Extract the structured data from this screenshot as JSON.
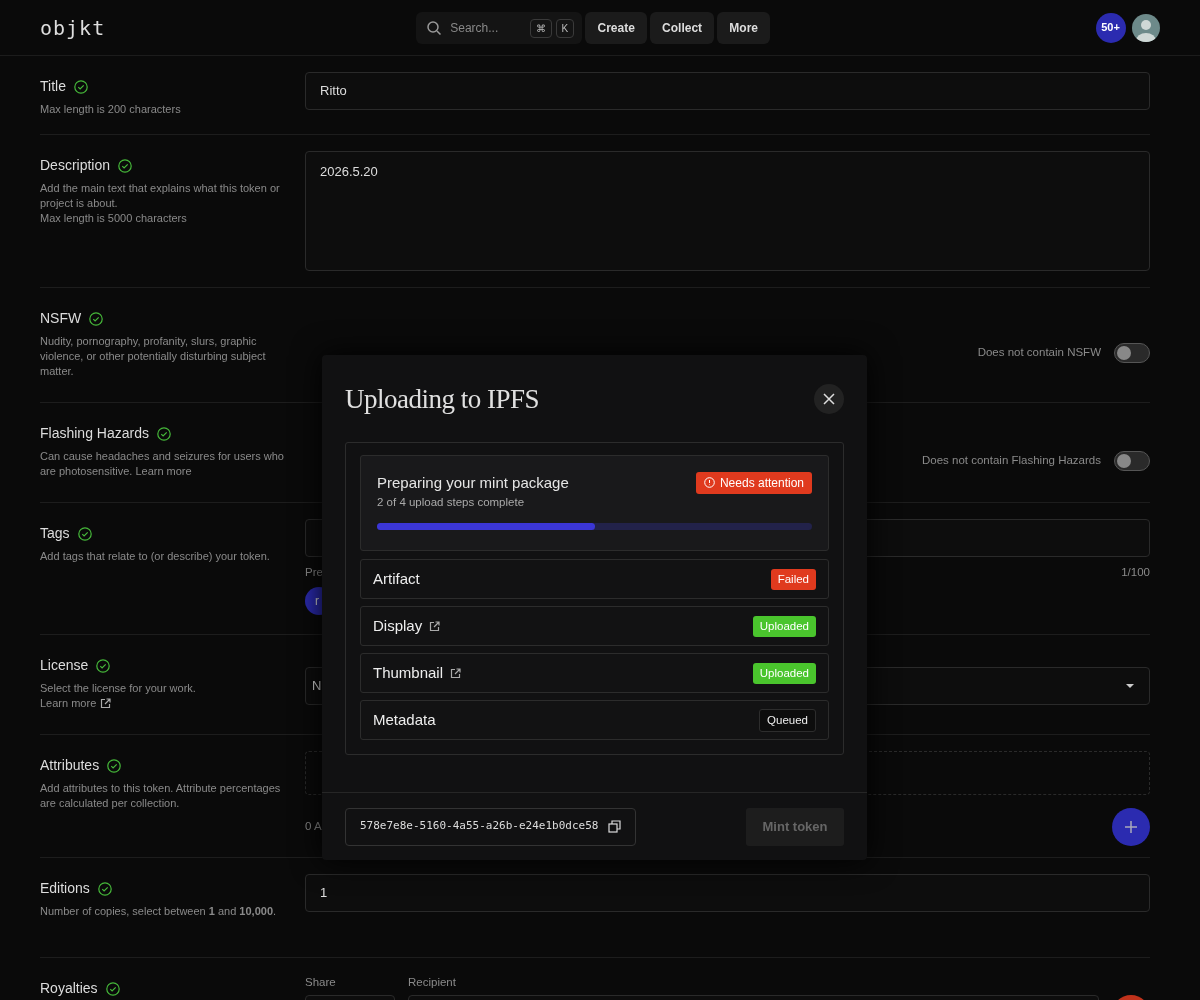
{
  "header": {
    "logo": "objkt",
    "search": {
      "placeholder": "Search...",
      "keys": [
        "⌘",
        "K"
      ]
    },
    "nav": [
      "Create",
      "Collect",
      "More"
    ],
    "notifications": "50+"
  },
  "form": {
    "fields": [
      {
        "kind": "text",
        "label": "Title",
        "valid": true,
        "help": [
          "Max length is 200 characters"
        ],
        "value": "Ritto"
      },
      {
        "kind": "textarea",
        "label": "Description",
        "valid": true,
        "help": [
          "Add the main text that explains what this token or project is about.",
          "Max length is 5000 characters"
        ],
        "value": "2026.5.20"
      },
      {
        "kind": "toggle",
        "label": "NSFW",
        "valid": true,
        "help": [
          "Nudity, pornography, profanity, slurs, graphic violence, or other potentially disturbing subject matter."
        ],
        "toggle_label": "Does not contain NSFW",
        "on": false
      },
      {
        "kind": "toggle",
        "label": "Flashing Hazards",
        "valid": true,
        "help": [
          "Can cause headaches and seizures for users who are photosensitive. Learn more"
        ],
        "toggle_label": "Does not contain Flashing Hazards",
        "on": false
      },
      {
        "kind": "tags",
        "label": "Tags",
        "valid": true,
        "help": [
          "Add tags that relate to (or describe) your token."
        ],
        "hint": "Pre",
        "count": "1/100",
        "chips": [
          "r"
        ]
      },
      {
        "kind": "select",
        "label": "License",
        "valid": true,
        "help": [
          "Select the license for your work."
        ],
        "link": "Learn more",
        "value": "N"
      },
      {
        "kind": "attributes",
        "label": "Attributes",
        "valid": true,
        "help": [
          "Add attributes to this token. Attribute percentages are calculated per collection."
        ],
        "hint": "0 A"
      },
      {
        "kind": "text",
        "label": "Editions",
        "valid": true,
        "help": [
          "Number of copies, select between **1** and **10,000**."
        ],
        "value": "1"
      },
      {
        "kind": "royalties",
        "label": "Royalties",
        "valid": true,
        "columns": [
          "Share",
          "Recipient"
        ]
      }
    ]
  },
  "modal": {
    "title": "Uploading to IPFS",
    "summary": {
      "title": "Preparing your mint package",
      "subtitle": "2 of 4 upload steps complete",
      "status": "Needs attention",
      "level": 0.5
    },
    "steps": [
      {
        "name": "Artifact",
        "link": false,
        "status": "Failed",
        "kind": "failed"
      },
      {
        "name": "Display",
        "link": true,
        "status": "Uploaded",
        "kind": "uploaded"
      },
      {
        "name": "Thumbnail",
        "link": true,
        "status": "Uploaded",
        "kind": "uploaded"
      },
      {
        "name": "Metadata",
        "link": false,
        "status": "Queued",
        "kind": "queued"
      }
    ],
    "token_id": "578e7e8e-5160-4a55-a26b-e24e1b0dce58",
    "mint_button": {
      "label": "Mint token",
      "disabled": true
    }
  }
}
